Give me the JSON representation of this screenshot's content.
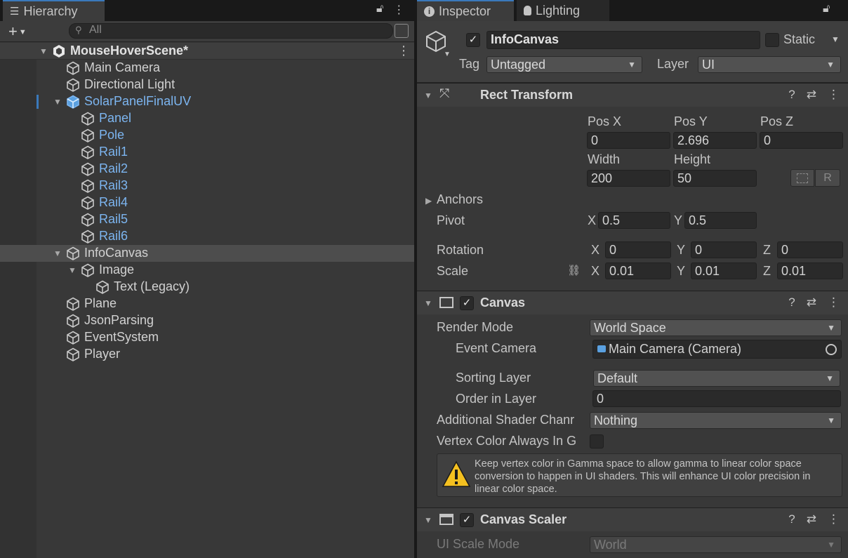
{
  "hierarchy": {
    "tab_label": "Hierarchy",
    "search_placeholder": "All",
    "scene_name": "MouseHoverScene*",
    "items": [
      {
        "label": "Main Camera",
        "color": "#d2d2d2"
      },
      {
        "label": "Directional Light",
        "color": "#d2d2d2"
      },
      {
        "label": "SolarPanelFinalUV",
        "color": "#7cb5f0"
      },
      {
        "label": "Panel",
        "color": "#7cb5f0"
      },
      {
        "label": "Pole",
        "color": "#7cb5f0"
      },
      {
        "label": "Rail1",
        "color": "#7cb5f0"
      },
      {
        "label": "Rail2",
        "color": "#7cb5f0"
      },
      {
        "label": "Rail3",
        "color": "#7cb5f0"
      },
      {
        "label": "Rail4",
        "color": "#7cb5f0"
      },
      {
        "label": "Rail5",
        "color": "#7cb5f0"
      },
      {
        "label": "Rail6",
        "color": "#7cb5f0"
      },
      {
        "label": "InfoCanvas",
        "color": "#d2d2d2"
      },
      {
        "label": "Image",
        "color": "#d2d2d2"
      },
      {
        "label": "Text (Legacy)",
        "color": "#d2d2d2"
      },
      {
        "label": "Plane",
        "color": "#d2d2d2"
      },
      {
        "label": "JsonParsing",
        "color": "#d2d2d2"
      },
      {
        "label": "EventSystem",
        "color": "#d2d2d2"
      },
      {
        "label": "Player",
        "color": "#d2d2d2"
      }
    ]
  },
  "inspector": {
    "tab_label": "Inspector",
    "lighting_tab_label": "Lighting",
    "object_name": "InfoCanvas",
    "static_label": "Static",
    "tag_label": "Tag",
    "tag_value": "Untagged",
    "layer_label": "Layer",
    "layer_value": "UI",
    "rect_transform": {
      "title": "Rect Transform",
      "pos_x_label": "Pos X",
      "pos_y_label": "Pos Y",
      "pos_z_label": "Pos Z",
      "pos_x": "0",
      "pos_y": "2.696",
      "pos_z": "0",
      "width_label": "Width",
      "height_label": "Height",
      "width": "200",
      "height": "50",
      "r_button": "R",
      "anchors_label": "Anchors",
      "pivot_label": "Pivot",
      "pivot_x": "0.5",
      "pivot_y": "0.5",
      "rotation_label": "Rotation",
      "rot_x": "0",
      "rot_y": "0",
      "rot_z": "0",
      "scale_label": "Scale",
      "scale_x": "0.01",
      "scale_y": "0.01",
      "scale_z": "0.01",
      "x": "X",
      "y": "Y",
      "z": "Z"
    },
    "canvas": {
      "title": "Canvas",
      "render_mode_label": "Render Mode",
      "render_mode": "World Space",
      "event_camera_label": "Event Camera",
      "event_camera": "Main Camera (Camera)",
      "sorting_layer_label": "Sorting Layer",
      "sorting_layer": "Default",
      "order_label": "Order in Layer",
      "order": "0",
      "shader_channels_label": "Additional Shader Chanr",
      "shader_channels": "Nothing",
      "vertex_color_label": "Vertex Color Always In G",
      "warning": "Keep vertex color in Gamma space to allow gamma to linear color space conversion to happen in UI shaders. This will enhance UI color precision in linear color space."
    },
    "canvas_scaler": {
      "title": "Canvas Scaler",
      "ui_scale_mode_label": "UI Scale Mode",
      "ui_scale_mode": "World"
    }
  },
  "colors": {
    "selection": "#4d4d4d",
    "accent": "#3a79bb",
    "prefab_blue": "#7cb5f0"
  }
}
